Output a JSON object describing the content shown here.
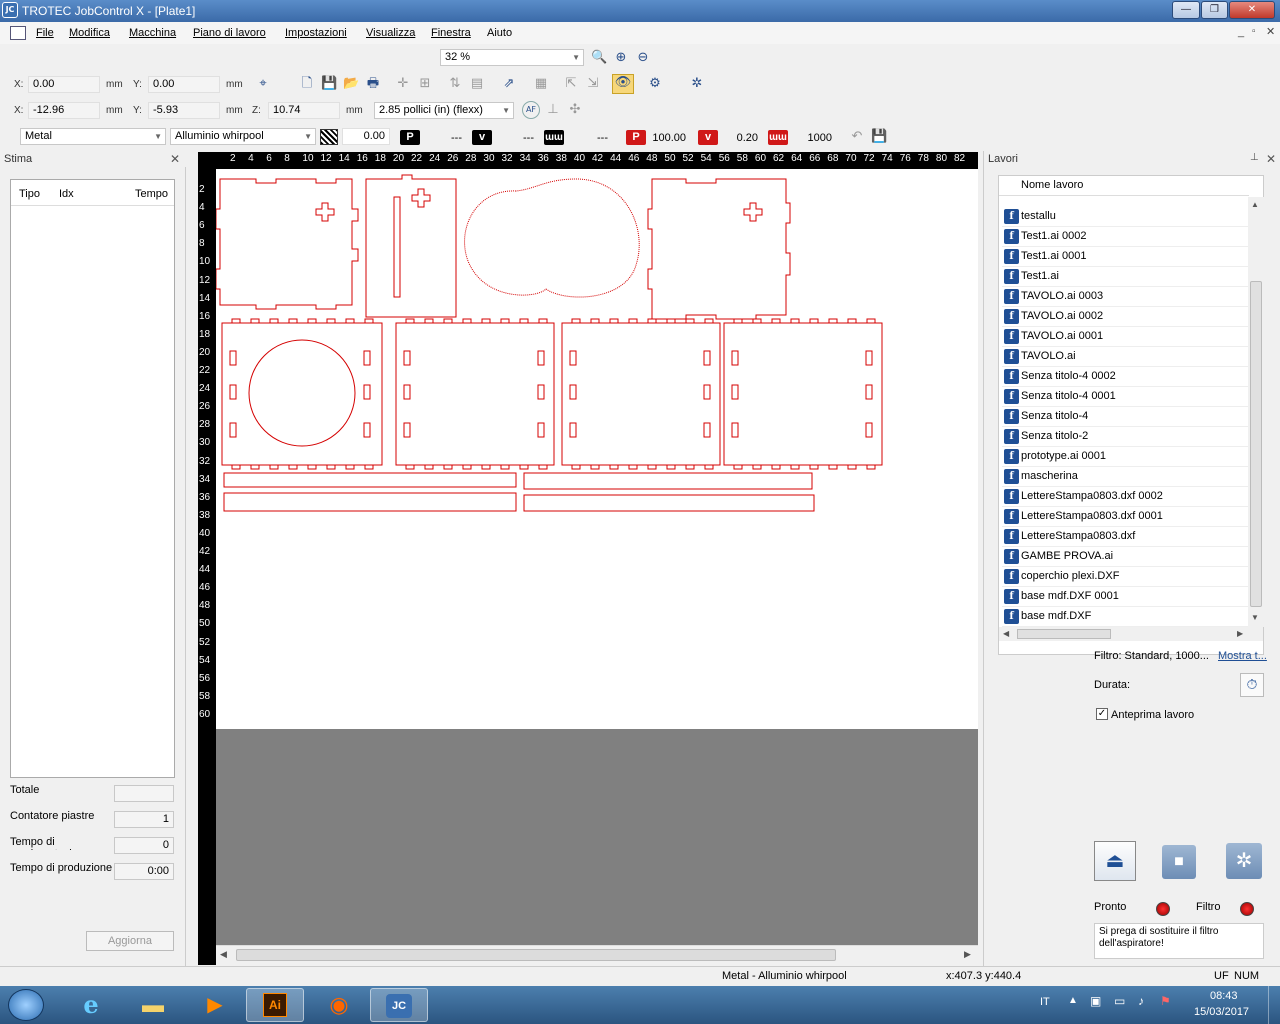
{
  "window": {
    "title": "TROTEC JobControl X - [Plate1]",
    "logo_text": "JC",
    "controls": [
      "—",
      "❐",
      "✕"
    ]
  },
  "menu": [
    "File",
    "Modifica",
    "Macchina",
    "Piano di lavoro",
    "Impostazioni",
    "Visualizza",
    "Finestra",
    "Aiuto"
  ],
  "zoom": {
    "value": "32 %"
  },
  "toolbar_pos": {
    "x_label": "X:",
    "x_value": "0.00",
    "x_unit": "mm",
    "y_label": "Y:",
    "y_value": "0.00",
    "y_unit": "mm"
  },
  "toolbar_pos2": {
    "x_label": "X:",
    "x_value": "-12.96",
    "x_unit": "mm",
    "y_label": "Y:",
    "y_value": "-5.93",
    "y_unit": "mm",
    "z_label": "Z:",
    "z_value": "10.74",
    "z_unit": "mm",
    "lens": "2.85 pollici (in) (flexx)"
  },
  "material_bar": {
    "material": "Metal",
    "submaterial": "Alluminio whirpool",
    "thickness": "0.00",
    "p_label": "P",
    "p_value": "---",
    "v_label": "v",
    "v_value": "---",
    "hz_value": "---",
    "p2_label": "P",
    "p2_value": "100.00",
    "v2_label": "v",
    "v2_value": "0.20",
    "hz2_value": "1000"
  },
  "stima": {
    "title": "Stima",
    "columns": [
      "Tipo",
      "Idx",
      "Tempo"
    ],
    "totale_label": "Totale",
    "totale_value": "",
    "contatore_label": "Contatore piastre",
    "contatore_value": "1",
    "movimentazione_label": "Tempo di movimentazione",
    "movimentazione_value": "0",
    "produzione_label": "Tempo di produzione",
    "produzione_value": "0:00",
    "aggiorna_label": "Aggiorna"
  },
  "ruler": {
    "top": [
      "2",
      "4",
      "6",
      "8",
      "10",
      "12",
      "14",
      "16",
      "18",
      "20",
      "22",
      "24",
      "26",
      "28",
      "30",
      "32",
      "34",
      "36",
      "38",
      "40",
      "42",
      "44",
      "46",
      "48",
      "50",
      "52",
      "54",
      "56",
      "58",
      "60",
      "62",
      "64",
      "66",
      "68",
      "70",
      "72",
      "74",
      "76",
      "78",
      "80",
      "82"
    ],
    "left": [
      "2",
      "4",
      "6",
      "8",
      "10",
      "12",
      "14",
      "16",
      "18",
      "20",
      "22",
      "24",
      "26",
      "28",
      "30",
      "32",
      "34",
      "36",
      "38",
      "40",
      "42",
      "44",
      "46",
      "48",
      "50",
      "52",
      "54",
      "56",
      "58",
      "60"
    ]
  },
  "lavori": {
    "title": "Lavori",
    "column": "Nome lavoro",
    "jobs": [
      "testallu",
      "Test1.ai 0002",
      "Test1.ai 0001",
      "Test1.ai",
      "TAVOLO.ai 0003",
      "TAVOLO.ai 0002",
      "TAVOLO.ai 0001",
      "TAVOLO.ai",
      "Senza titolo-4 0002",
      "Senza titolo-4 0001",
      "Senza titolo-4",
      "Senza titolo-2",
      "prototype.ai 0001",
      "mascherina",
      "LettereStampa0803.dxf 0002",
      "LettereStampa0803.dxf 0001",
      "LettereStampa0803.dxf",
      "GAMBE PROVA.ai",
      "coperchio plexi.DXF",
      "base mdf.DXF 0001",
      "base mdf.DXF"
    ],
    "filtro_text": "Filtro: Standard, 1000...",
    "mostra_link": "Mostra t...",
    "durata_label": "Durata:",
    "anteprima_label": "Anteprima lavoro",
    "pronto_label": "Pronto",
    "filtro_label": "Filtro",
    "message": "Si prega di sostituire il filtro dell'aspiratore!"
  },
  "statusbar": {
    "material": "Metal - Alluminio whirpool",
    "coords": "x:407.3   y:440.4",
    "uf": "UF",
    "num": "NUM"
  },
  "taskbar": {
    "lang": "IT",
    "time": "08:43",
    "date": "15/03/2017"
  },
  "colors": {
    "cut_red": "#d40000",
    "accent": "#1f4f95"
  }
}
